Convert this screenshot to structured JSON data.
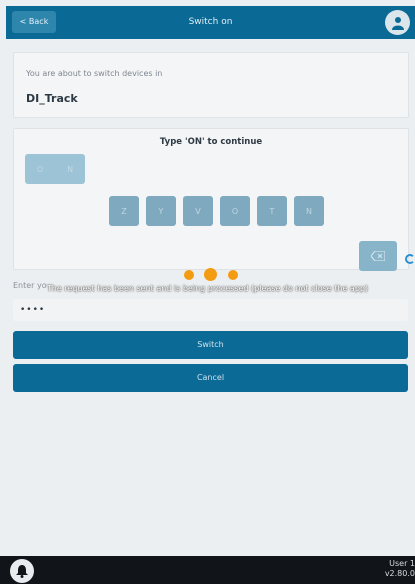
{
  "header": {
    "back_label": "< Back",
    "title": "Switch on"
  },
  "info": {
    "message": "You are about to switch devices in",
    "device": "DI_Track"
  },
  "keyboard": {
    "prompt": "Type 'ON' to continue",
    "slots": [
      "O",
      "N"
    ],
    "keys": [
      "Z",
      "Y",
      "V",
      "O",
      "T",
      "N"
    ],
    "backspace_icon": "backspace-icon"
  },
  "pin": {
    "label": "Enter yo",
    "value": "••••"
  },
  "actions": {
    "switch_label": "Switch",
    "cancel_label": "Cancel"
  },
  "overlay": {
    "message": "The request has been sent and is being processed (please do not close the app)",
    "dot_color": "#f39c12"
  },
  "footer": {
    "user_line1": "User 1",
    "user_line2": "v2.80.0"
  },
  "colors": {
    "primary": "#0b6a95",
    "key": "#7fa9bf",
    "background": "#eceff1"
  }
}
